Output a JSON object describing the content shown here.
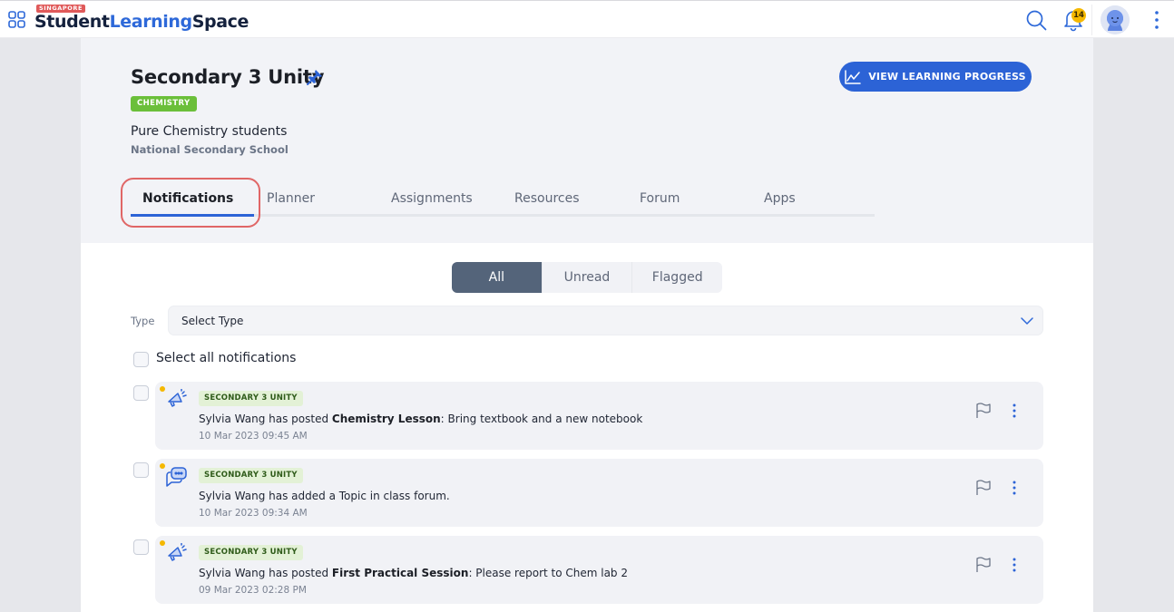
{
  "header": {
    "logo_country": "SINGAPORE",
    "logo_part1": "Student",
    "logo_part2": "Learning",
    "logo_part3": "Space",
    "notification_count": "14",
    "icons": [
      "apps-grid-icon",
      "search-icon",
      "bell-icon",
      "avatar",
      "more-vertical-icon"
    ]
  },
  "class_info": {
    "title": "Secondary 3 Unity",
    "subject_badge": "CHEMISTRY",
    "description": "Pure Chemistry students",
    "school": "National Secondary School",
    "progress_button": "VIEW LEARNING PROGRESS"
  },
  "tabs": [
    {
      "label": "Notifications",
      "active": true
    },
    {
      "label": "Planner",
      "active": false
    },
    {
      "label": "Assignments",
      "active": false
    },
    {
      "label": "Resources",
      "active": false
    },
    {
      "label": "Forum",
      "active": false
    },
    {
      "label": "Apps",
      "active": false
    }
  ],
  "filters": {
    "options": [
      "All",
      "Unread",
      "Flagged"
    ],
    "selected": "All"
  },
  "type_filter": {
    "label": "Type",
    "value": "Select Type"
  },
  "select_all_label": "Select all notifications",
  "notifications": [
    {
      "icon": "megaphone-icon",
      "class_tag": "SECONDARY 3 UNITY",
      "prefix": "Sylvia Wang has posted ",
      "bold": "Chemistry Lesson",
      "suffix": ": Bring textbook and a new notebook",
      "time": "10 Mar 2023 09:45 AM",
      "unread": true
    },
    {
      "icon": "chat-bubbles-icon",
      "class_tag": "SECONDARY 3 UNITY",
      "prefix": "Sylvia Wang has added a Topic in class forum.",
      "bold": "",
      "suffix": "",
      "time": "10 Mar 2023 09:34 AM",
      "unread": true
    },
    {
      "icon": "megaphone-icon",
      "class_tag": "SECONDARY 3 UNITY",
      "prefix": "Sylvia Wang has posted ",
      "bold": "First Practical Session",
      "suffix": ": Please report to Chem lab 2",
      "time": "09 Mar 2023 02:28 PM",
      "unread": true
    }
  ],
  "colors": {
    "brand_blue": "#2c63d6",
    "subject_green": "#6bbf3a",
    "unread_dot": "#f5b800",
    "highlight_red": "#e06666",
    "segment_active": "#54647a"
  }
}
